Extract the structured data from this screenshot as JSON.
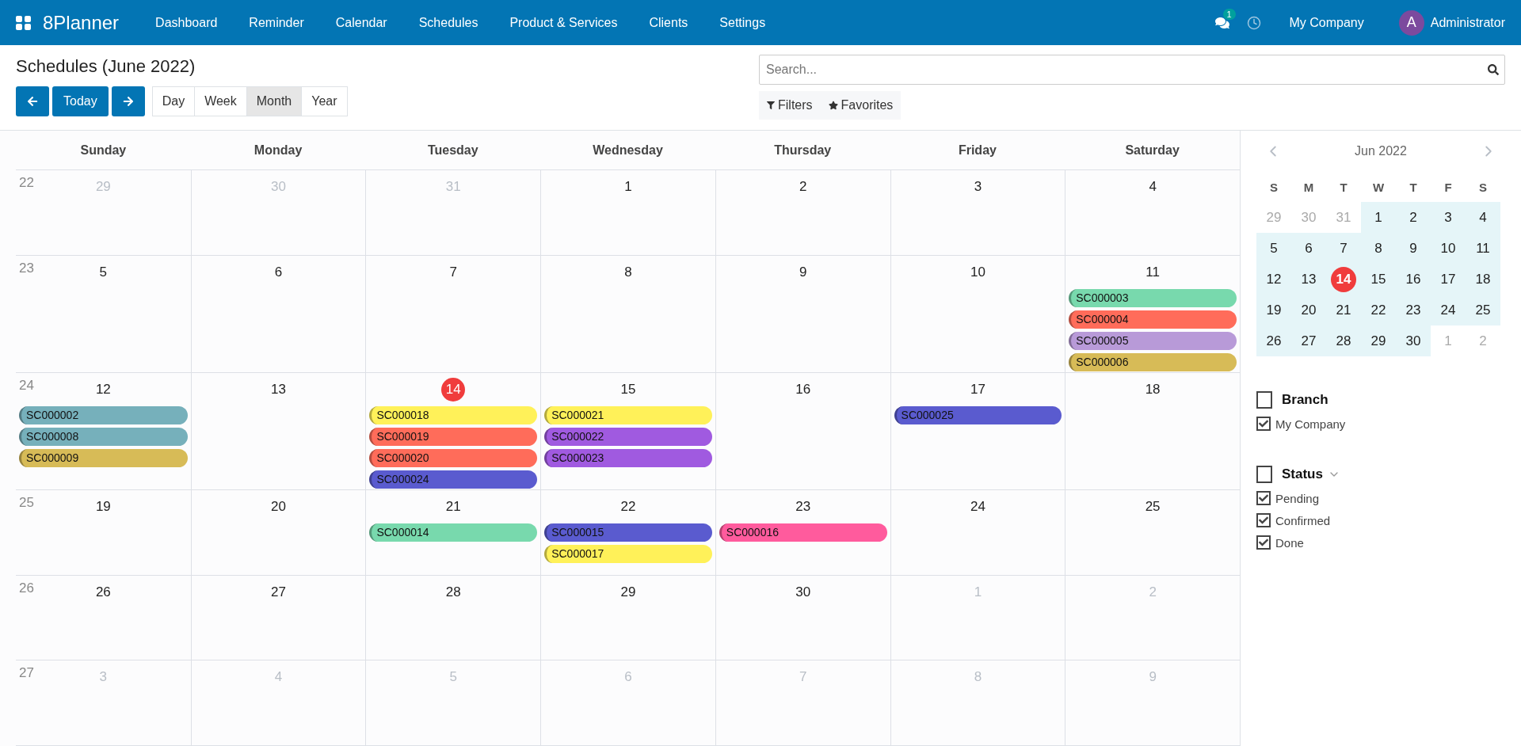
{
  "app": {
    "name": "8Planner"
  },
  "nav": [
    "Dashboard",
    "Reminder",
    "Calendar",
    "Schedules",
    "Product & Services",
    "Clients",
    "Settings"
  ],
  "topbar": {
    "messages_badge": "1",
    "company": "My Company",
    "avatar": "A",
    "user": "Administrator"
  },
  "page": {
    "title": "Schedules (June 2022)",
    "today_button": "Today"
  },
  "views": [
    {
      "label": "Day",
      "selected": false
    },
    {
      "label": "Week",
      "selected": false
    },
    {
      "label": "Month",
      "selected": true
    },
    {
      "label": "Year",
      "selected": false
    }
  ],
  "search": {
    "placeholder": "Search..."
  },
  "search_buttons": [
    {
      "kind": "filter",
      "label": "Filters"
    },
    {
      "kind": "star",
      "label": "Favorites"
    }
  ],
  "calendar": {
    "weekdays": [
      "Sunday",
      "Monday",
      "Tuesday",
      "Wednesday",
      "Thursday",
      "Friday",
      "Saturday"
    ],
    "weeks": [
      {
        "week": "22",
        "days": [
          {
            "day": "29",
            "in_month": false,
            "today": false
          },
          {
            "day": "30",
            "in_month": false,
            "today": false
          },
          {
            "day": "31",
            "in_month": false,
            "today": false
          },
          {
            "day": "1",
            "in_month": true,
            "today": false
          },
          {
            "day": "2",
            "in_month": true,
            "today": false
          },
          {
            "day": "3",
            "in_month": true,
            "today": false
          },
          {
            "day": "4",
            "in_month": true,
            "today": false
          }
        ]
      },
      {
        "week": "23",
        "days": [
          {
            "day": "5",
            "in_month": true,
            "today": false
          },
          {
            "day": "6",
            "in_month": true,
            "today": false
          },
          {
            "day": "7",
            "in_month": true,
            "today": false
          },
          {
            "day": "8",
            "in_month": true,
            "today": false
          },
          {
            "day": "9",
            "in_month": true,
            "today": false
          },
          {
            "day": "10",
            "in_month": true,
            "today": false
          },
          {
            "day": "11",
            "in_month": true,
            "today": false,
            "events": [
              {
                "code": "SC000003",
                "color": "#78d9ad"
              },
              {
                "code": "SC000004",
                "color": "#ff6c5a"
              },
              {
                "code": "SC000005",
                "color": "#b89ad8"
              },
              {
                "code": "SC000006",
                "color": "#d7bb57"
              }
            ]
          }
        ]
      },
      {
        "week": "24",
        "days": [
          {
            "day": "12",
            "in_month": true,
            "today": false,
            "events": [
              {
                "code": "SC000002",
                "color": "#76b0bb"
              },
              {
                "code": "SC000008",
                "color": "#76b0bb"
              },
              {
                "code": "SC000009",
                "color": "#d7bb57"
              }
            ]
          },
          {
            "day": "13",
            "in_month": true,
            "today": false
          },
          {
            "day": "14",
            "in_month": true,
            "today": true,
            "events": [
              {
                "code": "SC000018",
                "color": "#fff159"
              },
              {
                "code": "SC000019",
                "color": "#ff6c5a"
              },
              {
                "code": "SC000020",
                "color": "#ff6c5a"
              },
              {
                "code": "SC000024",
                "color": "#5a5bcf"
              }
            ]
          },
          {
            "day": "15",
            "in_month": true,
            "today": false,
            "events": [
              {
                "code": "SC000021",
                "color": "#fff159"
              },
              {
                "code": "SC000022",
                "color": "#a05ae0"
              },
              {
                "code": "SC000023",
                "color": "#a05ae0"
              }
            ]
          },
          {
            "day": "16",
            "in_month": true,
            "today": false
          },
          {
            "day": "17",
            "in_month": true,
            "today": false,
            "events": [
              {
                "code": "SC000025",
                "color": "#5a5bcf"
              }
            ]
          },
          {
            "day": "18",
            "in_month": true,
            "today": false
          }
        ]
      },
      {
        "week": "25",
        "days": [
          {
            "day": "19",
            "in_month": true,
            "today": false
          },
          {
            "day": "20",
            "in_month": true,
            "today": false
          },
          {
            "day": "21",
            "in_month": true,
            "today": false,
            "events": [
              {
                "code": "SC000014",
                "color": "#78d9ad"
              }
            ]
          },
          {
            "day": "22",
            "in_month": true,
            "today": false,
            "events": [
              {
                "code": "SC000015",
                "color": "#5a5bcf"
              },
              {
                "code": "SC000017",
                "color": "#fff159"
              }
            ]
          },
          {
            "day": "23",
            "in_month": true,
            "today": false,
            "events": [
              {
                "code": "SC000016",
                "color": "#ff5b9d"
              }
            ]
          },
          {
            "day": "24",
            "in_month": true,
            "today": false
          },
          {
            "day": "25",
            "in_month": true,
            "today": false
          }
        ]
      },
      {
        "week": "26",
        "days": [
          {
            "day": "26",
            "in_month": true,
            "today": false
          },
          {
            "day": "27",
            "in_month": true,
            "today": false
          },
          {
            "day": "28",
            "in_month": true,
            "today": false
          },
          {
            "day": "29",
            "in_month": true,
            "today": false
          },
          {
            "day": "30",
            "in_month": true,
            "today": false
          },
          {
            "day": "1",
            "in_month": false,
            "today": false
          },
          {
            "day": "2",
            "in_month": false,
            "today": false
          }
        ]
      },
      {
        "week": "27",
        "days": [
          {
            "day": "3",
            "in_month": false,
            "today": false
          },
          {
            "day": "4",
            "in_month": false,
            "today": false
          },
          {
            "day": "5",
            "in_month": false,
            "today": false
          },
          {
            "day": "6",
            "in_month": false,
            "today": false
          },
          {
            "day": "7",
            "in_month": false,
            "today": false
          },
          {
            "day": "8",
            "in_month": false,
            "today": false
          },
          {
            "day": "9",
            "in_month": false,
            "today": false
          }
        ]
      }
    ]
  },
  "mini_calendar": {
    "title": "Jun 2022",
    "weekdays": [
      "S",
      "M",
      "T",
      "W",
      "T",
      "F",
      "S"
    ],
    "weeks": [
      [
        {
          "day": "29",
          "in_month": false,
          "today": false
        },
        {
          "day": "30",
          "in_month": false,
          "today": false
        },
        {
          "day": "31",
          "in_month": false,
          "today": false
        },
        {
          "day": "1",
          "in_month": true,
          "today": false
        },
        {
          "day": "2",
          "in_month": true,
          "today": false
        },
        {
          "day": "3",
          "in_month": true,
          "today": false
        },
        {
          "day": "4",
          "in_month": true,
          "today": false
        }
      ],
      [
        {
          "day": "5",
          "in_month": true,
          "today": false
        },
        {
          "day": "6",
          "in_month": true,
          "today": false
        },
        {
          "day": "7",
          "in_month": true,
          "today": false
        },
        {
          "day": "8",
          "in_month": true,
          "today": false
        },
        {
          "day": "9",
          "in_month": true,
          "today": false
        },
        {
          "day": "10",
          "in_month": true,
          "today": false
        },
        {
          "day": "11",
          "in_month": true,
          "today": false
        }
      ],
      [
        {
          "day": "12",
          "in_month": true,
          "today": false
        },
        {
          "day": "13",
          "in_month": true,
          "today": false
        },
        {
          "day": "14",
          "in_month": true,
          "today": true
        },
        {
          "day": "15",
          "in_month": true,
          "today": false
        },
        {
          "day": "16",
          "in_month": true,
          "today": false
        },
        {
          "day": "17",
          "in_month": true,
          "today": false
        },
        {
          "day": "18",
          "in_month": true,
          "today": false
        }
      ],
      [
        {
          "day": "19",
          "in_month": true,
          "today": false
        },
        {
          "day": "20",
          "in_month": true,
          "today": false
        },
        {
          "day": "21",
          "in_month": true,
          "today": false
        },
        {
          "day": "22",
          "in_month": true,
          "today": false
        },
        {
          "day": "23",
          "in_month": true,
          "today": false
        },
        {
          "day": "24",
          "in_month": true,
          "today": false
        },
        {
          "day": "25",
          "in_month": true,
          "today": false
        }
      ],
      [
        {
          "day": "26",
          "in_month": true,
          "today": false
        },
        {
          "day": "27",
          "in_month": true,
          "today": false
        },
        {
          "day": "28",
          "in_month": true,
          "today": false
        },
        {
          "day": "29",
          "in_month": true,
          "today": false
        },
        {
          "day": "30",
          "in_month": true,
          "today": false
        },
        {
          "day": "1",
          "in_month": false,
          "today": false
        },
        {
          "day": "2",
          "in_month": false,
          "today": false
        }
      ]
    ]
  },
  "filters": [
    {
      "title": "Branch",
      "checked": false,
      "expandable": false,
      "items": [
        {
          "label": "My Company",
          "checked": true
        }
      ]
    },
    {
      "title": "Status",
      "checked": false,
      "expandable": true,
      "items": [
        {
          "label": "Pending",
          "checked": true
        },
        {
          "label": "Confirmed",
          "checked": true
        },
        {
          "label": "Done",
          "checked": true
        }
      ]
    }
  ]
}
